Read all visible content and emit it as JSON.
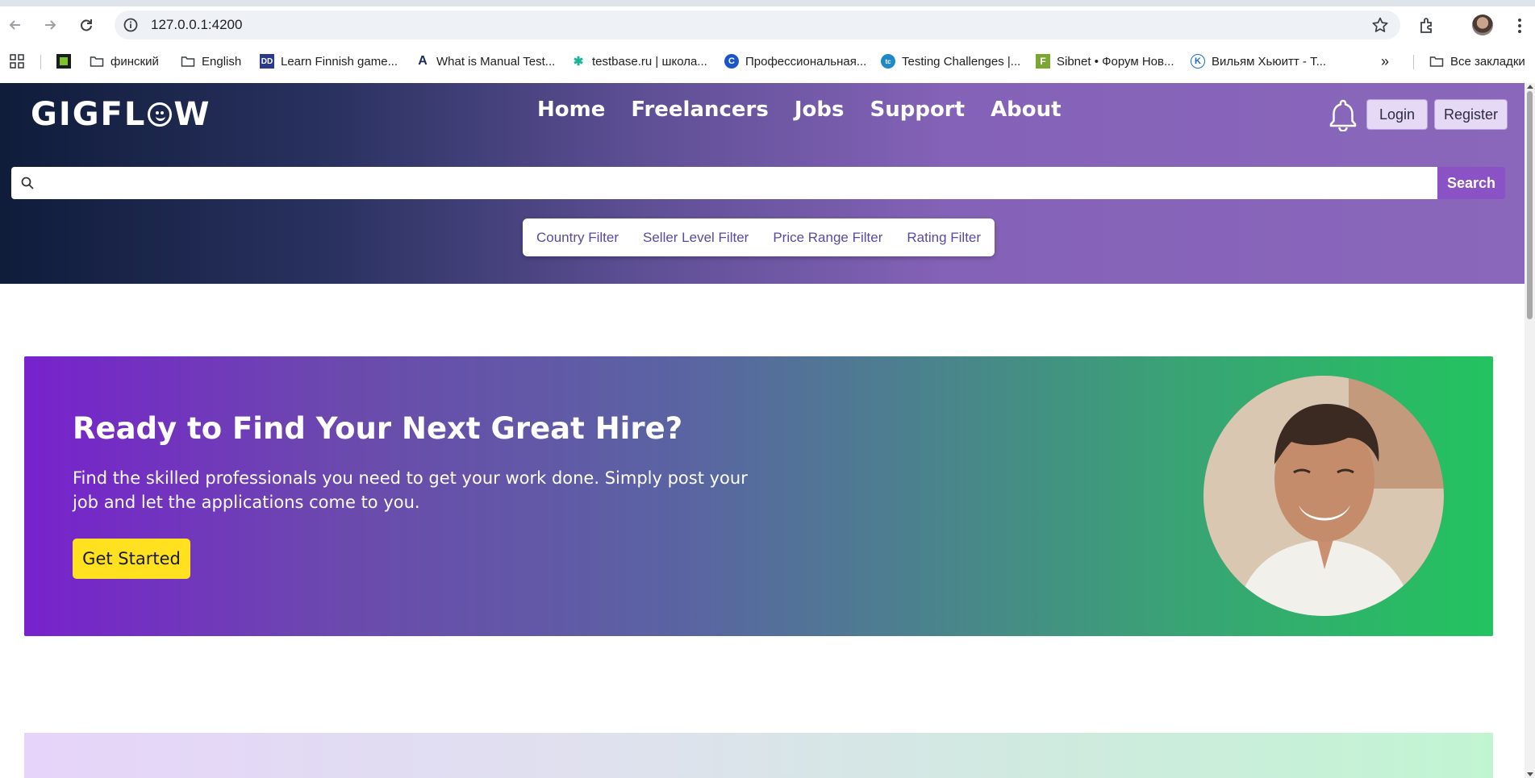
{
  "browser": {
    "url": "127.0.0.1:4200",
    "bookmarks": [
      {
        "label": "финский",
        "icon": "folder-icon"
      },
      {
        "label": "English",
        "icon": "folder-icon"
      },
      {
        "label": "Learn Finnish game...",
        "icon": "dd-favicon"
      },
      {
        "label": "What is Manual Test...",
        "icon": "a-favicon"
      },
      {
        "label": "testbase.ru | школа...",
        "icon": "bug-favicon"
      },
      {
        "label": "Профессиональная...",
        "icon": "c-favicon"
      },
      {
        "label": "Testing Challenges |...",
        "icon": "tc-favicon"
      },
      {
        "label": "Sibnet • Форум Нов...",
        "icon": "f-favicon"
      },
      {
        "label": "Вильям Хьюитт - Т...",
        "icon": "k-favicon"
      }
    ],
    "all_bookmarks": "Все закладки"
  },
  "header": {
    "logo": {
      "left": "GIGFL",
      "right": "W"
    },
    "nav": [
      "Home",
      "Freelancers",
      "Jobs",
      "Support",
      "About"
    ],
    "login": "Login",
    "register": "Register"
  },
  "search": {
    "placeholder": "",
    "button": "Search"
  },
  "filters": [
    "Country Filter",
    "Seller Level Filter",
    "Price Range Filter",
    "Rating Filter"
  ],
  "hero": {
    "title": "Ready to Find Your Next Great Hire?",
    "text": "Find the skilled professionals you need to get your work done. Simply post your job and let the applications come to you.",
    "cta": "Get Started"
  },
  "colors": {
    "accent": "#8a52c4",
    "cta": "#ffe120",
    "filter_text": "#5b4a9b"
  }
}
